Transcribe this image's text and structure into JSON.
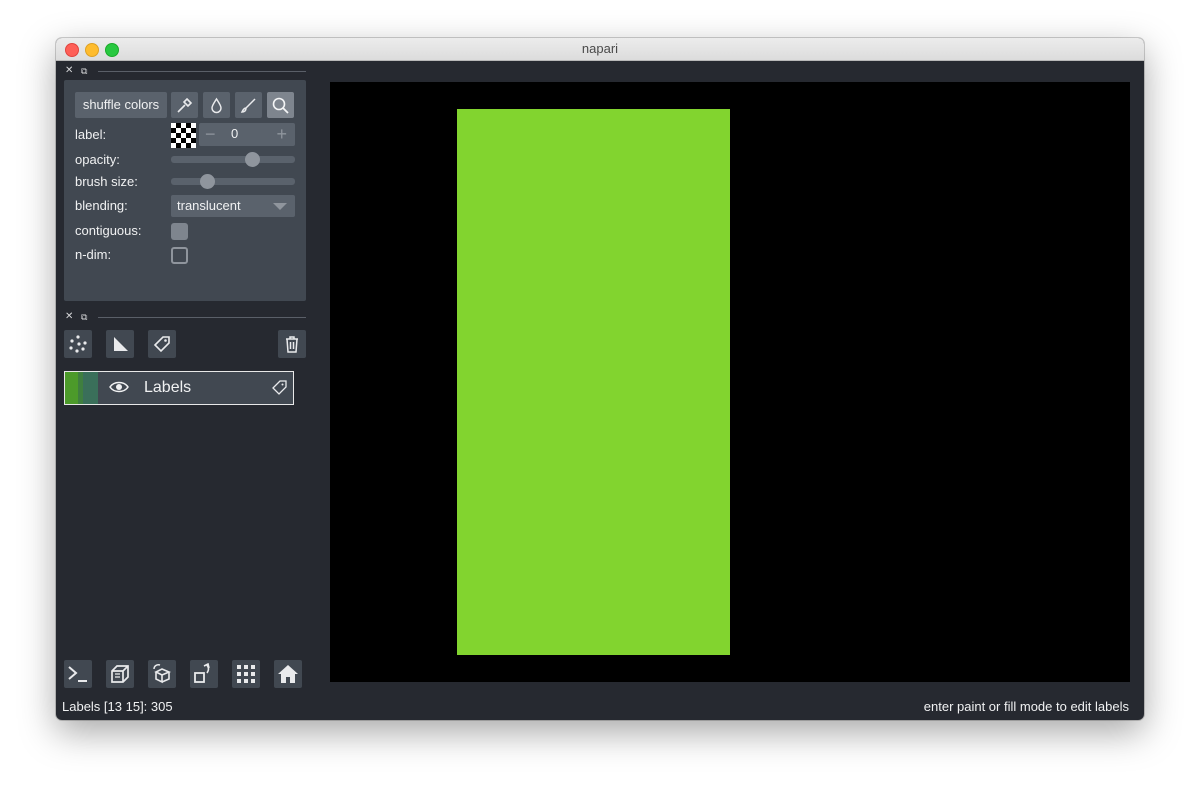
{
  "window": {
    "title": "napari"
  },
  "layer_controls": {
    "shuffle_label": "shuffle colors",
    "label_caption": "label:",
    "label_value": "0",
    "minus": "−",
    "plus": "+",
    "opacity_caption": "opacity:",
    "opacity_level": 0.68,
    "brush_caption": "brush size:",
    "brush_level": 0.27,
    "blending_caption": "blending:",
    "blending_value": "translucent",
    "contiguous_caption": "contiguous:",
    "contiguous_checked": true,
    "ndim_caption": "n-dim:",
    "ndim_checked": false,
    "modes": [
      "picker-icon",
      "fill-icon",
      "paint-icon",
      "zoom-icon"
    ],
    "active_mode": "zoom-icon"
  },
  "layer_list": {
    "buttons": [
      "new-points-icon",
      "new-shapes-icon",
      "new-labels-icon",
      "delete-icon"
    ],
    "layers": [
      {
        "name": "Labels"
      }
    ]
  },
  "bottom_toolbar": [
    "console-icon",
    "ndisplay-icon",
    "roll-icon",
    "transpose-icon",
    "grid-icon",
    "home-icon"
  ],
  "canvas": {
    "background": "#000000",
    "label_color": "#82d42f"
  },
  "status": {
    "left": "Labels [13 15]: 305",
    "right": "enter paint or fill mode to edit labels"
  }
}
